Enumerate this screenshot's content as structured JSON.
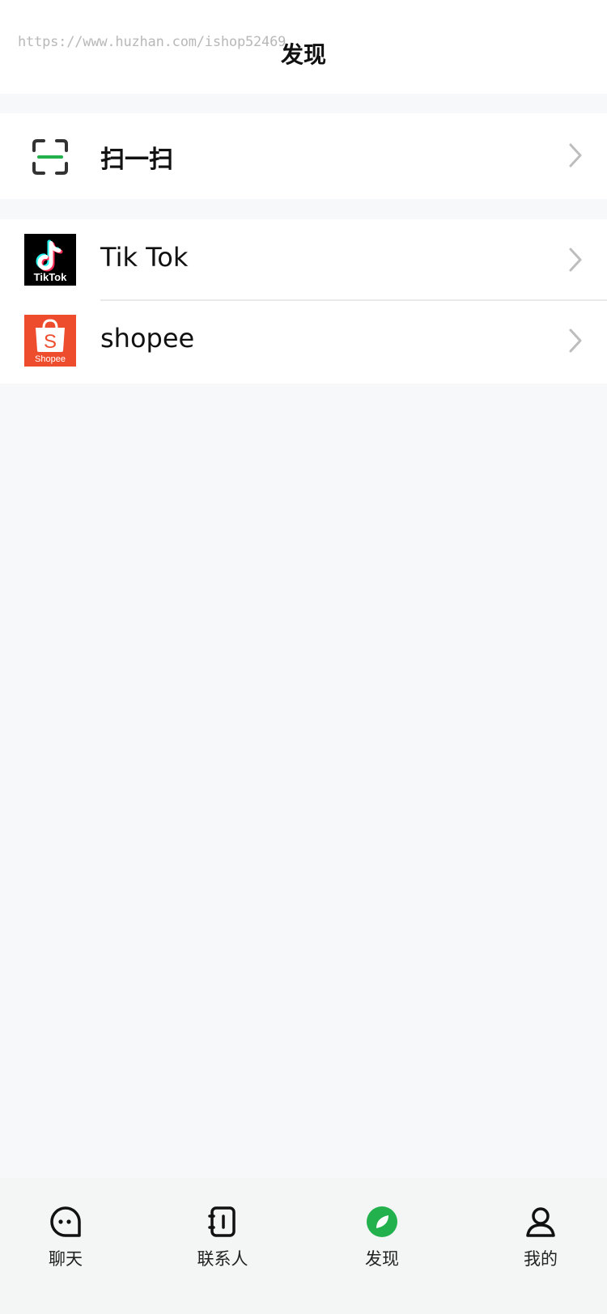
{
  "header": {
    "watermark": "https://www.huzhan.com/ishop52469",
    "title": "发现"
  },
  "scan": {
    "label": "扫一扫",
    "icon": "scan-icon"
  },
  "apps": [
    {
      "label": "Tik Tok",
      "icon": "tiktok-logo-icon",
      "logo_text": "TikTok"
    },
    {
      "label": "shopee",
      "icon": "shopee-logo-icon",
      "logo_text": "Shopee"
    }
  ],
  "tabbar": {
    "items": [
      {
        "label": "聊天",
        "icon": "chat-icon"
      },
      {
        "label": "联系人",
        "icon": "contacts-icon"
      },
      {
        "label": "发现",
        "icon": "discover-icon",
        "active": true
      },
      {
        "label": "我的",
        "icon": "profile-icon"
      }
    ]
  },
  "colors": {
    "accent": "#22b14c",
    "shopee": "#ee4d2d",
    "tiktok_bg": "#000000",
    "page_bg": "#f7f8fa"
  }
}
